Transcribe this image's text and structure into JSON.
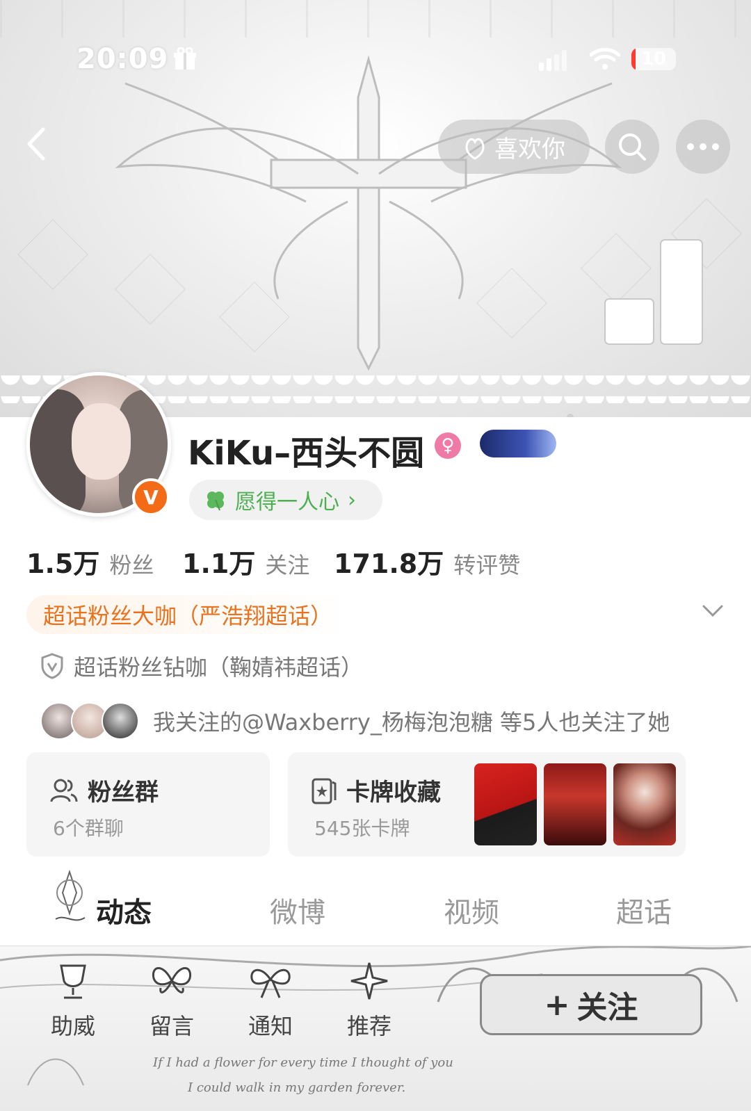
{
  "status_bar": {
    "time": "20:09",
    "battery": "10",
    "battery_level": 0.1
  },
  "nav": {
    "like_label": "喜欢你"
  },
  "profile": {
    "username": "KiKu–西头不圆",
    "verified_mark": "V",
    "gender_symbol": "♀",
    "bio": "愿得一人心",
    "bio_arrow": "›"
  },
  "stats": [
    {
      "value": "1.5万",
      "label": "粉丝"
    },
    {
      "value": "1.1万",
      "label": "关注"
    },
    {
      "value": "171.8万",
      "label": "转评赞"
    }
  ],
  "super_topic": {
    "primary": "超话粉丝大咖（严浩翔超话）",
    "secondary": "超话粉丝钻咖（鞠婧祎超话）"
  },
  "mutual": {
    "text": "我关注的@Waxberry_杨梅泡泡糖  等5人也关注了她"
  },
  "cards": {
    "fan_group": {
      "title": "粉丝群",
      "subtitle": "6个群聊"
    },
    "collection": {
      "title": "卡牌收藏",
      "subtitle": "545张卡牌"
    }
  },
  "tabs": [
    "动态",
    "微博",
    "视频",
    "超话"
  ],
  "bottom_bar": {
    "items": [
      "助威",
      "留言",
      "通知",
      "推荐"
    ],
    "follow_label": "关注",
    "follow_plus": "+",
    "script_line1": "If I had a flower for every time I thought of you",
    "script_line2": "I could walk in my garden forever."
  },
  "colors": {
    "accent_orange": "#e8721d",
    "bio_green": "#4caf50",
    "verified": "#f36b16"
  }
}
